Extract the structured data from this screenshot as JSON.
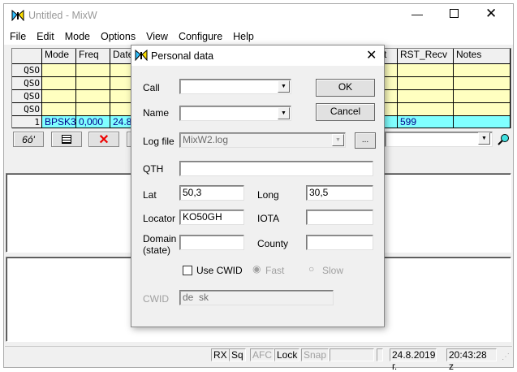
{
  "window": {
    "title": "Untitled - MixW"
  },
  "menu": [
    "File",
    "Edit",
    "Mode",
    "Options",
    "View",
    "Configure",
    "Help"
  ],
  "grid": {
    "headers": {
      "mode": "Mode",
      "freq": "Freq",
      "date": "Date",
      "rst_sent_tail": "t",
      "rst_recv": "RST_Recv",
      "notes": "Notes"
    },
    "qso_rows": [
      "QSO",
      "QSO",
      "QSO",
      "QSO"
    ],
    "current": {
      "num": "1",
      "mode": "BPSK3",
      "freq": "0,000",
      "date": "24.8",
      "rst_recv": "599"
    }
  },
  "toolbar": {
    "combo_value": ""
  },
  "status": {
    "rx": "RX",
    "sq": "Sq",
    "afc": "AFC",
    "lock": "Lock",
    "snap": "Snap",
    "date": "24.8.2019 г.",
    "time": "20:43:28 z"
  },
  "dialog": {
    "title": "Personal data",
    "call_label": "Call",
    "call_value": "",
    "name_label": "Name",
    "name_value": "",
    "logfile_label": "Log file",
    "logfile_value": "MixW2.log",
    "browse": "...",
    "ok": "OK",
    "cancel": "Cancel",
    "qth_label": "QTH",
    "qth_value": "",
    "lat_label": "Lat",
    "lat_value": "50,3",
    "long_label": "Long",
    "long_value": "30,5",
    "locator_label": "Locator",
    "locator_value": "KO50GH",
    "iota_label": "IOTA",
    "iota_value": "",
    "domain_label": "Domain (state)",
    "domain_value": "",
    "county_label": "County",
    "county_value": "",
    "use_cwid": "Use CWID",
    "use_cwid_checked": false,
    "fast": "Fast",
    "slow": "Slow",
    "cwid_label": "CWID",
    "cwid_value": "de  sk"
  }
}
